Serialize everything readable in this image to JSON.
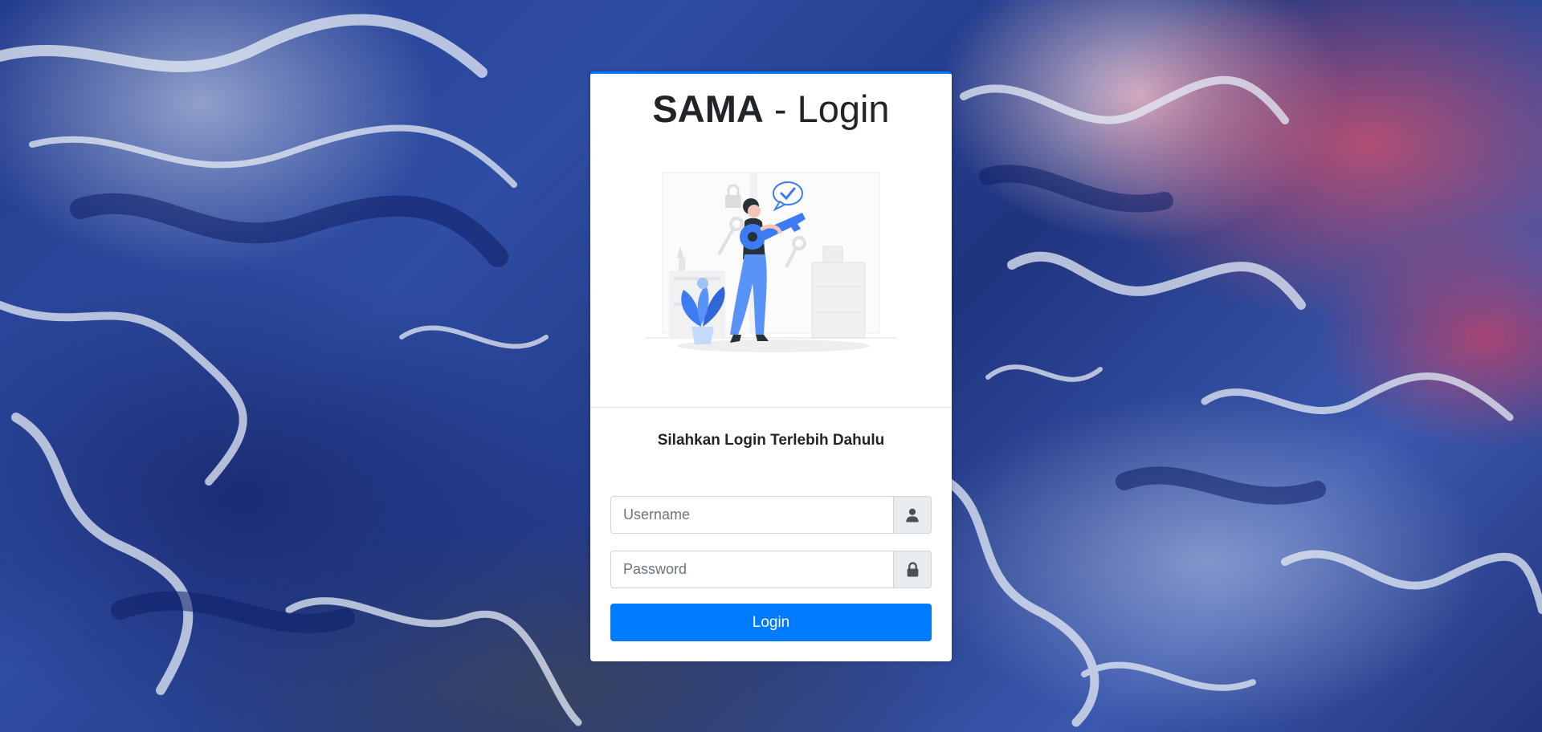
{
  "colors": {
    "primary": "#007bff",
    "card_bg": "#ffffff",
    "text": "#212529",
    "addon_bg": "#e9ecef",
    "illustration_accent": "#3d7bf5"
  },
  "login": {
    "title_brand": "SAMA",
    "title_rest": " - Login",
    "message": "Silahkan Login Terlebih Dahulu",
    "username": {
      "placeholder": "Username",
      "value": "",
      "icon": "user-icon"
    },
    "password": {
      "placeholder": "Password",
      "value": "",
      "icon": "lock-icon"
    },
    "button_label": "Login"
  }
}
